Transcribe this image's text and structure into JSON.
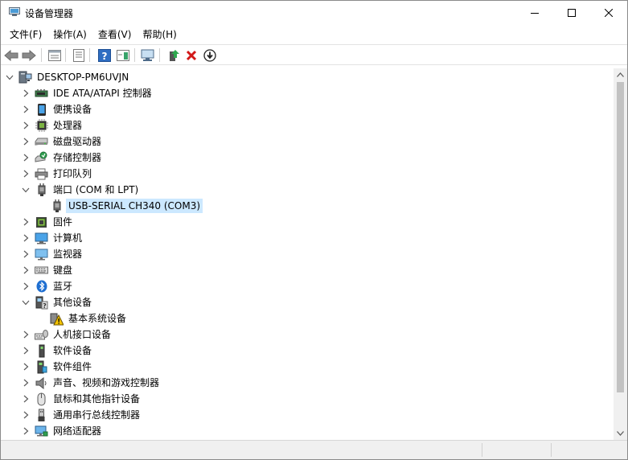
{
  "window": {
    "title": "设备管理器"
  },
  "menu": [
    {
      "label": "文件(F)"
    },
    {
      "label": "操作(A)"
    },
    {
      "label": "查看(V)"
    },
    {
      "label": "帮助(H)"
    }
  ],
  "toolbar": [
    "back-arrow-icon",
    "forward-arrow-icon",
    "properties-icon",
    "driver-details-icon",
    "help-icon",
    "action-pane-icon",
    "scan-hardware-icon",
    "update-driver-icon",
    "uninstall-device-icon",
    "download-icon"
  ],
  "tree": {
    "root": "DESKTOP-PM6UVJN",
    "items": [
      {
        "label": "IDE ATA/ATAPI 控制器",
        "icon": "ide-controller-icon",
        "expanded": false
      },
      {
        "label": "便携设备",
        "icon": "portable-device-icon",
        "expanded": false
      },
      {
        "label": "处理器",
        "icon": "processor-icon",
        "expanded": false
      },
      {
        "label": "磁盘驱动器",
        "icon": "disk-drive-icon",
        "expanded": false
      },
      {
        "label": "存储控制器",
        "icon": "storage-controller-icon",
        "expanded": false
      },
      {
        "label": "打印队列",
        "icon": "printer-icon",
        "expanded": false
      },
      {
        "label": "端口 (COM 和 LPT)",
        "icon": "port-icon",
        "expanded": true,
        "children": [
          {
            "label": "USB-SERIAL CH340 (COM3)",
            "icon": "port-icon",
            "selected": true
          }
        ]
      },
      {
        "label": "固件",
        "icon": "firmware-icon",
        "expanded": false
      },
      {
        "label": "计算机",
        "icon": "computer-icon",
        "expanded": false
      },
      {
        "label": "监视器",
        "icon": "monitor-icon",
        "expanded": false
      },
      {
        "label": "键盘",
        "icon": "keyboard-icon",
        "expanded": false
      },
      {
        "label": "蓝牙",
        "icon": "bluetooth-icon",
        "expanded": false
      },
      {
        "label": "其他设备",
        "icon": "other-devices-icon",
        "expanded": true,
        "children": [
          {
            "label": "基本系统设备",
            "icon": "warning-device-icon",
            "selected": false
          }
        ]
      },
      {
        "label": "人机接口设备",
        "icon": "hid-icon",
        "expanded": false
      },
      {
        "label": "软件设备",
        "icon": "software-device-icon",
        "expanded": false
      },
      {
        "label": "软件组件",
        "icon": "software-component-icon",
        "expanded": false
      },
      {
        "label": "声音、视频和游戏控制器",
        "icon": "sound-icon",
        "expanded": false
      },
      {
        "label": "鼠标和其他指针设备",
        "icon": "mouse-icon",
        "expanded": false
      },
      {
        "label": "通用串行总线控制器",
        "icon": "usb-icon",
        "expanded": false
      },
      {
        "label": "网络适配器",
        "icon": "network-adapter-icon",
        "expanded": false
      }
    ]
  },
  "colors": {
    "selection": "#cce8ff",
    "warning": "#f5c400",
    "accent": "#0078d7"
  }
}
